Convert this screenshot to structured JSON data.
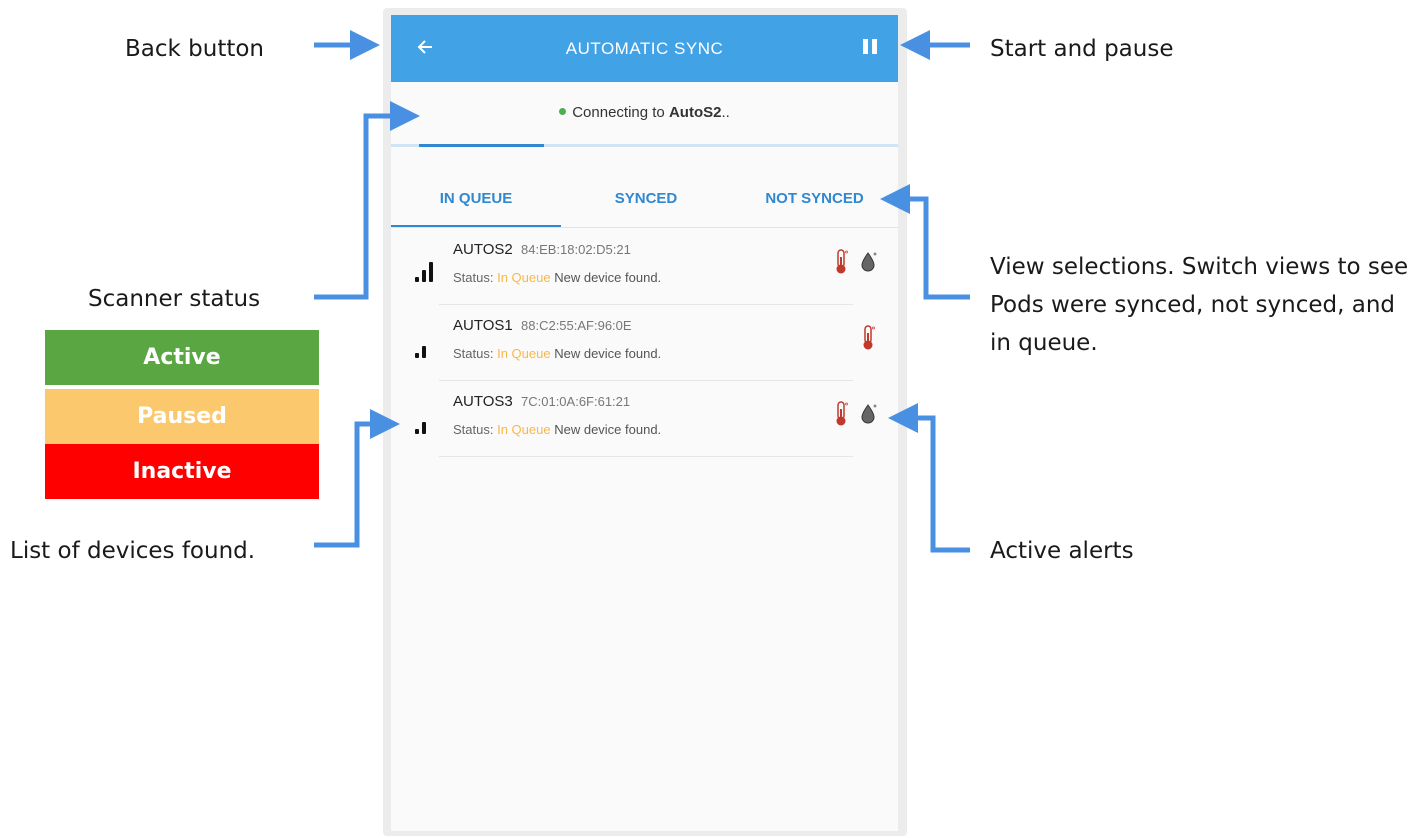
{
  "annotations": {
    "back_button": "Back button",
    "start_pause": "Start and pause",
    "scanner_status": "Scanner status",
    "view_selections": "View selections. Switch views to see Pods were synced, not synced, and in queue.",
    "list_of_devices": "List of devices found.",
    "active_alerts": "Active alerts"
  },
  "legend": {
    "active": "Active",
    "paused": "Paused",
    "inactive": "Inactive"
  },
  "colors": {
    "appbar": "#42a2e6",
    "tab_accent": "#2f88d0",
    "arrow": "#4a90e2",
    "active": "#5aa642",
    "paused": "#fcc86e",
    "inactive": "#fe0000",
    "in_queue": "#f7b84b",
    "connected_dot": "#4caf50"
  },
  "app": {
    "title": "AUTOMATIC SYNC",
    "back_icon": "arrow-left-icon",
    "pause_icon": "pause-icon",
    "status_prefix": "Connecting to",
    "status_device": "AutoS2",
    "status_suffix": "..",
    "sync_progress": 0.25
  },
  "tabs": [
    {
      "label": "IN QUEUE",
      "selected": true
    },
    {
      "label": "SYNCED",
      "selected": false
    },
    {
      "label": "NOT SYNCED",
      "selected": false
    }
  ],
  "devices": [
    {
      "name": "AUTOS2",
      "mac": "84:EB:18:02:D5:21",
      "status_label": "Status:",
      "status_value": "In Queue",
      "message": "New device found.",
      "signal_bars": 3,
      "alerts": [
        "thermometer-icon",
        "humidity-drop-icon"
      ]
    },
    {
      "name": "AUTOS1",
      "mac": "88:C2:55:AF:96:0E",
      "status_label": "Status:",
      "status_value": "In Queue",
      "message": "New device found.",
      "signal_bars": 2,
      "alerts": [
        "thermometer-icon"
      ]
    },
    {
      "name": "AUTOS3",
      "mac": "7C:01:0A:6F:61:21",
      "status_label": "Status:",
      "status_value": "In Queue",
      "message": "New device found.",
      "signal_bars": 2,
      "alerts": [
        "thermometer-icon",
        "humidity-drop-icon"
      ]
    }
  ]
}
